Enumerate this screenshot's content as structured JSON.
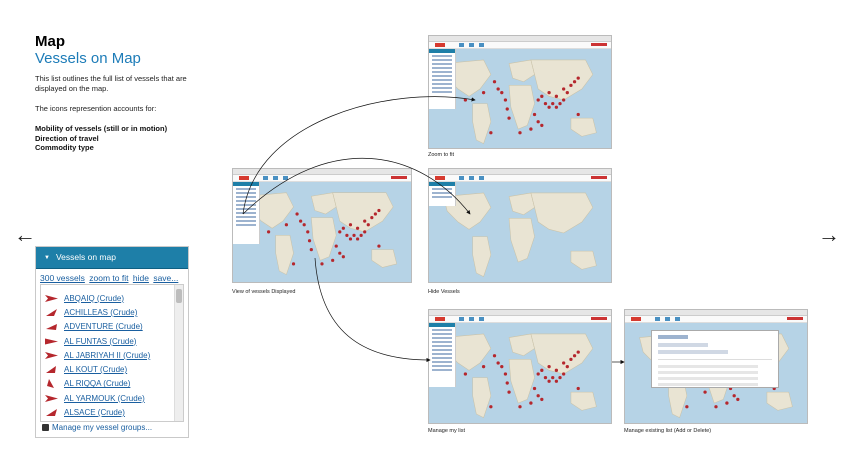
{
  "left": {
    "title": "Map",
    "subtitle": "Vessels on Map",
    "intro": "This list outlines the full list of vessels that are displayed on the map.",
    "icons_text": "The icons represention accounts for:",
    "bullets": [
      "Mobility of vessels (still or in motion)",
      "Direction of travel",
      "Commodity type"
    ]
  },
  "nav": {
    "prev": "←",
    "next": "→"
  },
  "panel": {
    "header": "Vessels on map",
    "links": [
      "300 vessels",
      "zoom to fit",
      "hide",
      "save..."
    ],
    "vessels": [
      "ABQAIQ (Crude)",
      "ACHILLEAS (Crude)",
      "ADVENTURE (Crude)",
      "AL FUNTAS (Crude)",
      "AL JABRIYAH II (Crude)",
      "AL KOUT (Crude)",
      "AL RIQQA (Crude)",
      "AL YARMOUK (Crude)",
      "ALSACE (Crude)"
    ],
    "manage_groups": "Manage my vessel groups..."
  },
  "captions": {
    "zoom_to_fit": "Zoom to fit",
    "view_displayed": "View of vessels Displayed",
    "hide_vessels": "Hide Vessels",
    "manage_list": "Manage my list",
    "manage_existing": "Manage existing list (Add or Delete)"
  },
  "colors": {
    "accent": "#1e7fa8",
    "link": "#1a5fa0",
    "ship": "#b5272d",
    "ocean": "#b6d3e6",
    "land": "#e9e4d3"
  }
}
